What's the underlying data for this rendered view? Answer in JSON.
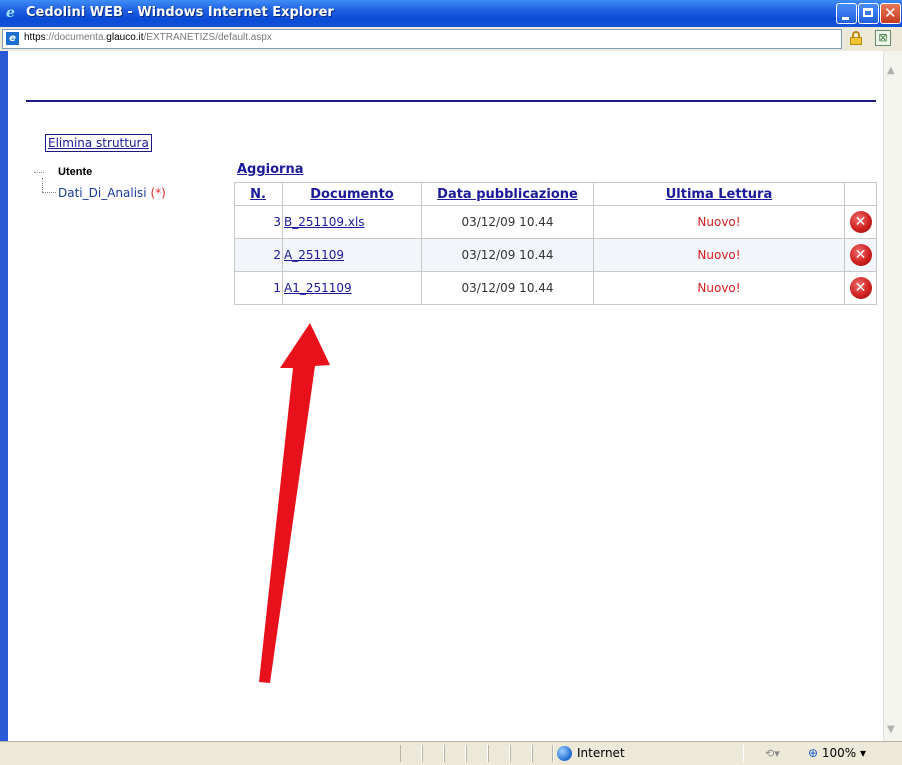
{
  "window": {
    "title": "Cedolini WEB - Windows Internet Explorer",
    "address": {
      "scheme": "https",
      "sep": "://documenta.",
      "host": "glauco.it",
      "path": "/EXTRANETIZS/default.aspx"
    }
  },
  "page": {
    "elimina_label": "Elimina struttura",
    "tree": {
      "root": "Utente",
      "child": "Dati_Di_Analisi",
      "child_marker": "(*)"
    },
    "aggiorna_label": "Aggiorna",
    "table": {
      "headers": [
        "N.",
        "Documento",
        "Data pubblicazione",
        "Ultima Lettura"
      ],
      "rows": [
        {
          "n": "3",
          "documento": "B_251109.xls",
          "data": "03/12/09 10.44",
          "ultima_lettura": "Nuovo!"
        },
        {
          "n": "2",
          "documento": "A_251109",
          "data": "03/12/09 10.44",
          "ultima_lettura": "Nuovo!"
        },
        {
          "n": "1",
          "documento": "A1_251109",
          "data": "03/12/09 10.44",
          "ultima_lettura": "Nuovo!"
        }
      ]
    }
  },
  "statusbar": {
    "zone": "Internet",
    "zoom": "100%"
  },
  "annotation": {
    "arrow_color": "#e8101a"
  }
}
